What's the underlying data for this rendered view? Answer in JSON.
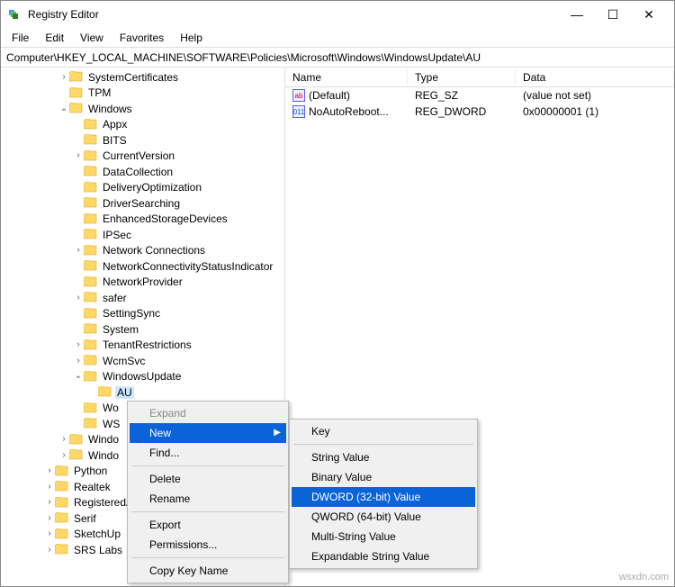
{
  "window": {
    "title": "Registry Editor"
  },
  "menu": {
    "file": "File",
    "edit": "Edit",
    "view": "View",
    "favorites": "Favorites",
    "help": "Help"
  },
  "address": "Computer\\HKEY_LOCAL_MACHINE\\SOFTWARE\\Policies\\Microsoft\\Windows\\WindowsUpdate\\AU",
  "list": {
    "cols": {
      "name": "Name",
      "type": "Type",
      "data": "Data"
    },
    "rows": [
      {
        "icon": "sz",
        "name": "(Default)",
        "type": "REG_SZ",
        "data": "(value not set)"
      },
      {
        "icon": "dw",
        "name": "NoAutoReboot...",
        "type": "REG_DWORD",
        "data": "0x00000001 (1)"
      }
    ]
  },
  "tree": [
    {
      "d": 4,
      "t": ">",
      "n": "SystemCertificates"
    },
    {
      "d": 4,
      "t": "",
      "n": "TPM"
    },
    {
      "d": 4,
      "t": "v",
      "n": "Windows"
    },
    {
      "d": 5,
      "t": "",
      "n": "Appx"
    },
    {
      "d": 5,
      "t": "",
      "n": "BITS"
    },
    {
      "d": 5,
      "t": ">",
      "n": "CurrentVersion"
    },
    {
      "d": 5,
      "t": "",
      "n": "DataCollection"
    },
    {
      "d": 5,
      "t": "",
      "n": "DeliveryOptimization"
    },
    {
      "d": 5,
      "t": "",
      "n": "DriverSearching"
    },
    {
      "d": 5,
      "t": "",
      "n": "EnhancedStorageDevices"
    },
    {
      "d": 5,
      "t": "",
      "n": "IPSec"
    },
    {
      "d": 5,
      "t": ">",
      "n": "Network Connections"
    },
    {
      "d": 5,
      "t": "",
      "n": "NetworkConnectivityStatusIndicator"
    },
    {
      "d": 5,
      "t": "",
      "n": "NetworkProvider"
    },
    {
      "d": 5,
      "t": ">",
      "n": "safer"
    },
    {
      "d": 5,
      "t": "",
      "n": "SettingSync"
    },
    {
      "d": 5,
      "t": "",
      "n": "System"
    },
    {
      "d": 5,
      "t": ">",
      "n": "TenantRestrictions"
    },
    {
      "d": 5,
      "t": ">",
      "n": "WcmSvc"
    },
    {
      "d": 5,
      "t": "v",
      "n": "WindowsUpdate"
    },
    {
      "d": 6,
      "t": "",
      "n": "AU",
      "sel": true
    },
    {
      "d": 5,
      "t": "",
      "n": "Wo"
    },
    {
      "d": 5,
      "t": "",
      "n": "WS"
    },
    {
      "d": 4,
      "t": ">",
      "n": "Windo"
    },
    {
      "d": 4,
      "t": ">",
      "n": "Windo"
    },
    {
      "d": 3,
      "t": ">",
      "n": "Python"
    },
    {
      "d": 3,
      "t": ">",
      "n": "Realtek"
    },
    {
      "d": 3,
      "t": ">",
      "n": "RegisteredAp"
    },
    {
      "d": 3,
      "t": ">",
      "n": "Serif"
    },
    {
      "d": 3,
      "t": ">",
      "n": "SketchUp"
    },
    {
      "d": 3,
      "t": ">",
      "n": "SRS Labs"
    }
  ],
  "ctx1": {
    "expand": "Expand",
    "new": "New",
    "find": "Find...",
    "delete": "Delete",
    "rename": "Rename",
    "export": "Export",
    "permissions": "Permissions...",
    "copykey": "Copy Key Name"
  },
  "ctx2": {
    "key": "Key",
    "string": "String Value",
    "binary": "Binary Value",
    "dword": "DWORD (32-bit) Value",
    "qword": "QWORD (64-bit) Value",
    "multi": "Multi-String Value",
    "expand": "Expandable String Value"
  },
  "watermark": "wsxdn.com"
}
